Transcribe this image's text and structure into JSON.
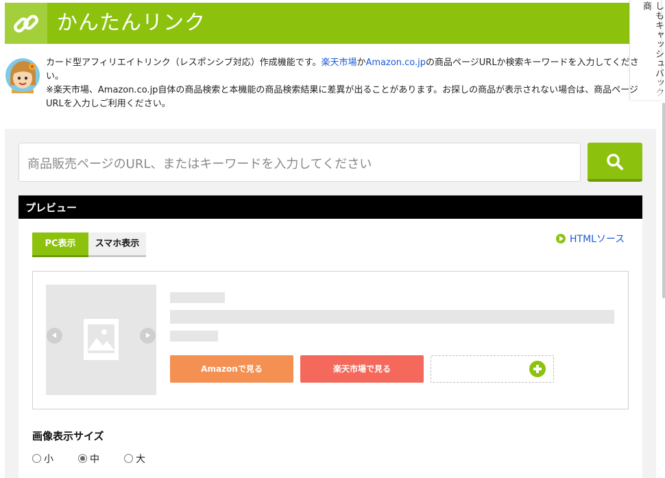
{
  "header": {
    "title": "かんたんリンク",
    "icon": "link-icon",
    "bg_color": "#8cc20e"
  },
  "side_tab": {
    "text": "しもキャッシュバック商"
  },
  "description": {
    "line1_before": "カード型アフィリエイトリンク（レスポンシブ対応）作成機能です。",
    "link_rakuten": "楽天市場",
    "connector": "か",
    "link_amazon": "Amazon.co.jp",
    "line1_after": "の商品ページURLか検索キーワードを入力してください。",
    "line2": "※楽天市場、Amazon.co.jp自体の商品検索と本機能の商品検索結果に差異が出ることがあります。お探しの商品が表示されない場合は、商品ページURLを入力しご利用ください。"
  },
  "search": {
    "placeholder": "商品販売ページのURL、またはキーワードを入力してください",
    "button_icon": "search-icon"
  },
  "preview": {
    "title": "プレビュー",
    "tabs": [
      {
        "label": "PC表示",
        "active": true
      },
      {
        "label": "スマホ表示",
        "active": false
      }
    ],
    "html_source_label": "HTMLソース",
    "card": {
      "amazon_button": "Amazonで見る",
      "rakuten_button": "楽天市場で見る",
      "add_icon": "plus-circle-icon"
    }
  },
  "image_size": {
    "heading": "画像表示サイズ",
    "options": [
      {
        "label": "小",
        "checked": false
      },
      {
        "label": "中",
        "checked": true
      },
      {
        "label": "大",
        "checked": false
      }
    ]
  },
  "colors": {
    "accent": "#8cc20e",
    "amazon": "#f49052",
    "rakuten": "#f4695b",
    "link": "#1a5ad6"
  }
}
